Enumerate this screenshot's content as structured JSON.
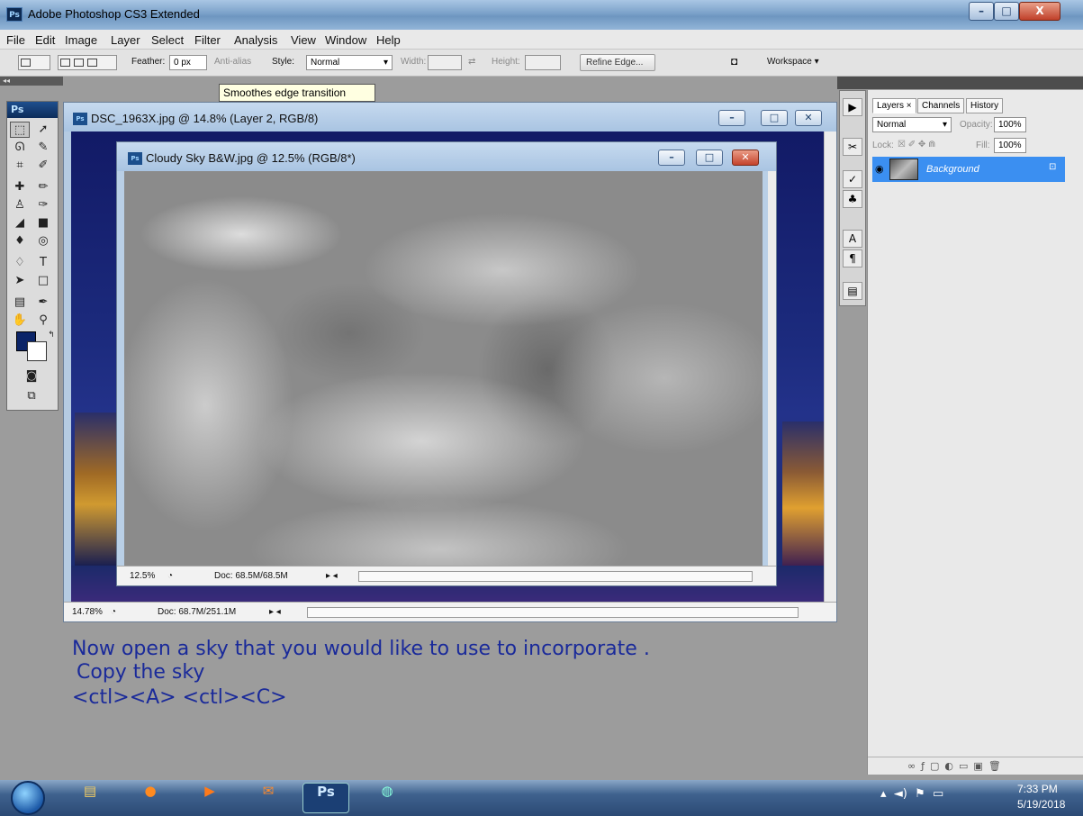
{
  "app": {
    "title": "Adobe Photoshop CS3 Extended",
    "badge": "Ps"
  },
  "window_controls": {
    "minimize": "–",
    "maximize": "□",
    "close": "X"
  },
  "menu": [
    "File",
    "Edit",
    "Image",
    "Layer",
    "Select",
    "Filter",
    "Analysis",
    "View",
    "Window",
    "Help"
  ],
  "options_bar": {
    "feather_label": "Feather:",
    "feather_value": "0 px",
    "antialias_label": "Anti-alias",
    "style_label": "Style:",
    "style_value": "Normal",
    "width_label": "Width:",
    "height_label": "Height:",
    "refine_edge": "Refine Edge...",
    "workspace": "Workspace ▾"
  },
  "tooltip": "Smoothes edge transition",
  "toolbox": {
    "logo": "Ps",
    "foreground_color": "#0b2468",
    "background_color": "#ffffff"
  },
  "doc_back": {
    "title": "DSC_1963X.jpg @ 14.8% (Layer 2, RGB/8)",
    "zoom": "14.78%",
    "doc_size": "Doc: 68.7M/251.1M"
  },
  "doc_front": {
    "title": "Cloudy Sky B&W.jpg @ 12.5% (RGB/8*)",
    "zoom": "12.5%",
    "doc_size": "Doc: 68.5M/68.5M"
  },
  "instructions": {
    "line1": "Now open a sky that you would like to use to incorporate .",
    "line2": "Copy the sky",
    "line3": "<ctl><A>  <ctl><C>"
  },
  "layers_panel": {
    "tabs": [
      "Layers ×",
      "Channels",
      "History"
    ],
    "blend_mode": "Normal",
    "opacity_label": "Opacity:",
    "opacity_value": "100%",
    "lock_label": "Lock:",
    "fill_label": "Fill:",
    "fill_value": "100%",
    "layer_name": "Background",
    "selection_color": "#3b8ff1"
  },
  "taskbar": {
    "ps_label": "Ps",
    "time": "7:33 PM",
    "date": "5/19/2018"
  }
}
